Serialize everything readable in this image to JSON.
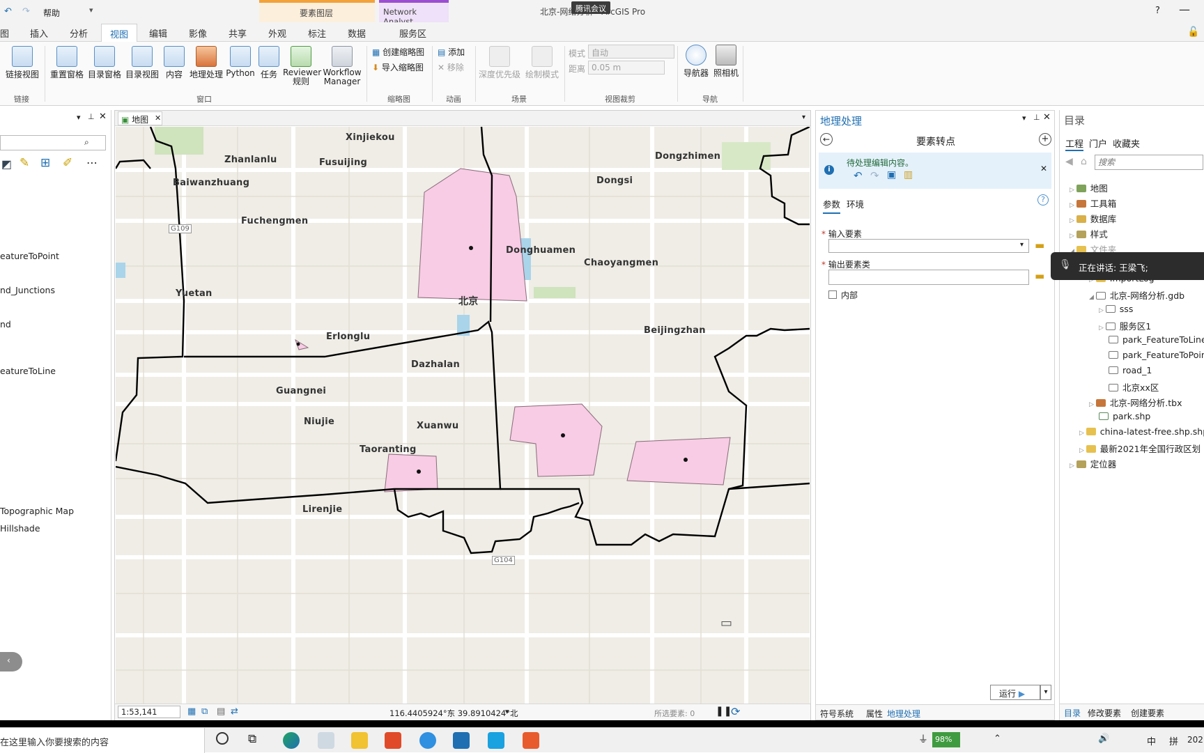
{
  "window": {
    "title": "北京-网络分析 - ArcGIS Pro",
    "help_label": "帮助",
    "meeting_badge": "腾讯会议"
  },
  "ribbon_tabs": [
    {
      "label": "图"
    },
    {
      "label": "插入"
    },
    {
      "label": "分析"
    },
    {
      "label": "视图"
    },
    {
      "label": "编辑"
    },
    {
      "label": "影像"
    },
    {
      "label": "共享"
    },
    {
      "label": "外观"
    },
    {
      "label": "标注"
    },
    {
      "label": "数据"
    },
    {
      "label": "服务区"
    }
  ],
  "context_groups": {
    "feature_layer": "要素图层",
    "network_analyst": "Network Analyst"
  },
  "ribbon": {
    "link_views": "链接视图",
    "reset_panes": "重置窗格",
    "catalog_pane": "目录窗格",
    "catalog_view": "目录视图",
    "contents": "内容",
    "geoprocessing": "地理处理",
    "python": "Python",
    "tasks": "任务",
    "reviewer_1": "Reviewer",
    "reviewer_2": "规则",
    "workflow_1": "Workflow",
    "workflow_2": "Manager",
    "create_thumbnail": "创建缩略图",
    "import_thumbnail": "导入缩略图",
    "add": "添加",
    "remove": "移除",
    "depth_priority": "深度优先级",
    "draw_mode": "绘制模式",
    "mode_label": "模式",
    "mode_value": "自动",
    "distance_label": "距离",
    "distance_value": "0.05 m",
    "navigator": "导航器",
    "camera": "照相机",
    "groups": {
      "link": "链接",
      "window": "窗口",
      "thumbnail": "缩略图",
      "animation": "动画",
      "scene": "场景",
      "view_clip": "视图裁剪",
      "navigation": "导航"
    }
  },
  "left_pane": {
    "items": [
      "eatureToPoint",
      "nd_Junctions",
      "nd",
      "eatureToLine",
      "Topographic Map",
      "Hillshade"
    ]
  },
  "map": {
    "tab_label": "地图",
    "scale": "1:53,141",
    "coordinates": "116.4405924°东 39.8910424°北",
    "selected_features": "所选要素: 0",
    "labels": {
      "xinjiekou": "Xinjiekou",
      "zhanlanlu": "Zhanlanlu",
      "fusuijing": "Fusuijing",
      "baiwanzhuang": "Baiwanzhuang",
      "fuchengmen": "Fuchengmen",
      "yuetan": "Yuetan",
      "erlonglu": "Erlonglu",
      "dazhalan": "Dazhalan",
      "guangnei": "Guangnei",
      "niujie": "Niujie",
      "xuanwu": "Xuanwu",
      "taoranting": "Taoranting",
      "lirenjie": "Lirenjie",
      "dongzhimen": "Dongzhimen",
      "dongsi": "Dongsi",
      "donghuamen": "Donghuamen",
      "chaoyangmen": "Chaoyangmen",
      "beijingzhan": "Beijingzhan",
      "beijing": "北京",
      "g109": "G109",
      "g104": "G104"
    }
  },
  "geoprocessing": {
    "pane_title": "地理处理",
    "tool_title": "要素转点",
    "info_text": "待处理编辑内容。",
    "tab_params": "参数",
    "tab_env": "环境",
    "input_label": "输入要素",
    "output_label": "输出要素类",
    "inside_label": "内部",
    "run_label": "运行",
    "bottom_tabs": [
      "符号系统",
      "属性",
      "地理处理"
    ]
  },
  "catalog": {
    "pane_title": "目录",
    "tabs": [
      "工程",
      "门户",
      "收藏夹"
    ],
    "search_placeholder": "搜索",
    "tree": [
      "地图",
      "工具箱",
      "数据库",
      "样式",
      "文件夹",
      "ImportLog",
      "北京-网络分析.gdb",
      "sss",
      "服务区1",
      "park_FeatureToLine",
      "park_FeatureToPoint",
      "road_1",
      "北京xx区",
      "北京-网络分析.tbx",
      "park.shp",
      "china-latest-free.shp.shp",
      "最新2021年全国行政区划",
      "定位器"
    ],
    "bottom_tabs": [
      "目录",
      "修改要素",
      "创建要素"
    ]
  },
  "meeting": {
    "speaking": "正在讲话: 王梁飞;"
  },
  "taskbar": {
    "search_placeholder": "在这里输入你要搜索的内容",
    "battery": "98%",
    "ime": "中",
    "ime2": "拼",
    "clock": "202"
  },
  "colors": {
    "accent": "#1f6fb2",
    "polygon_fill": "#f7cce4",
    "boundary": "#000000",
    "map_bg": "#efede6",
    "context_orange": "#f2a23a",
    "context_purple": "#9b4fd0"
  }
}
